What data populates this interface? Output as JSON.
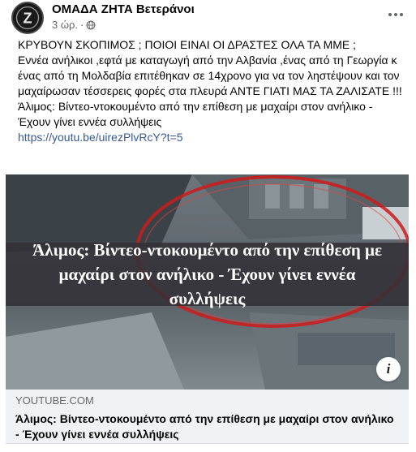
{
  "header": {
    "page_name": "ΟΜΑΔΑ ΖΗΤΑ Βετεράνοι",
    "time": "3 ώρ.",
    "separator": "·",
    "avatar_letter": "Z",
    "privacy_icon": "globe-icon",
    "more_icon": "more-horizontal-icon"
  },
  "post": {
    "text": "ΚΡΥΒΟΥΝ ΣΚΟΠΙΜΟΣ ; ΠΟΙΟΙ ΕΙΝΑΙ ΟΙ ΔΡΑΣΤΕΣ ΟΛΑ ΤΑ ΜΜΕ ;\nΕννέα ανήλικοι ,εφτά με καταγωγή από την Αλβανία ,ένας από τη Γεωργία κ ένας από τη Μολδαβία επιτέθηκαν σε 14χρονο για να τον ληστέψουν και τον μαχαίρωσαν τέσσερεις φορές στα πλευρά ΑΝΤΕ ΓΙΑΤΙ ΜΑΣ ΤΑ ΖΑΛΙΣΑΤΕ !!!\nΆλιμος: Βίντεο-ντοκουμέντο από την επίθεση με μαχαίρι στον ανήλικο - Έχουν γίνει εννέα συλλήψεις",
    "link": "https://youtu.be/uirezPlvRcY?t=5"
  },
  "preview": {
    "banner_text": "Άλιμος: Βίντεο-ντοκουμέντο από την επίθεση με μαχαίρι στον ανήλικο - Έχουν γίνει εννέα συλλήψεις",
    "info_label": "i",
    "info_icon": "info-icon"
  },
  "link_footer": {
    "domain": "YOUTUBE.COM",
    "title": "Άλιμος: Βίντεο-ντοκουμέντο από την επίθεση με μαχαίρι στον ανήλικο - Έχουν γίνει εννέα συλλήψεις"
  },
  "colors": {
    "link": "#385898",
    "secondary_text": "#65676b",
    "footer_bg": "#f0f2f5",
    "highlight_circle": "#d01a1a"
  }
}
